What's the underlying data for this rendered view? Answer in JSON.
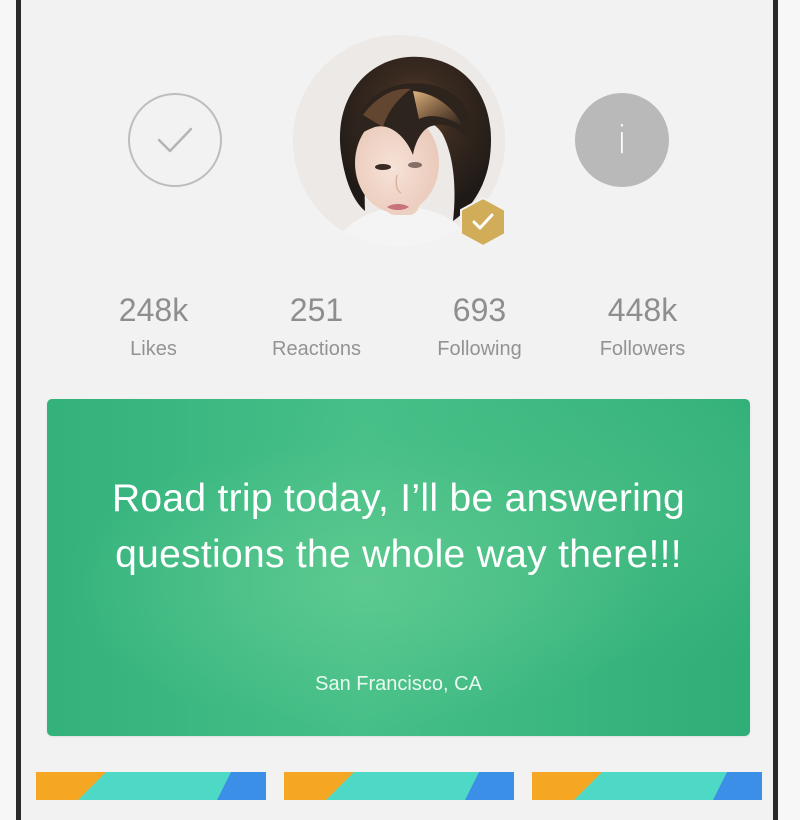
{
  "profile": {
    "avatar_alt": "Profile photo",
    "verified": true
  },
  "stats": [
    {
      "value": "248k",
      "label": "Likes"
    },
    {
      "value": "251",
      "label": "Reactions"
    },
    {
      "value": "693",
      "label": "Following"
    },
    {
      "value": "448k",
      "label": "Followers"
    }
  ],
  "info_button": {
    "glyph": "i"
  },
  "status": {
    "text": "Road trip today, I’ll be answering questions the whole way there!!!",
    "location": "San Francisco, CA"
  },
  "colors": {
    "card_green": "#3bb882",
    "badge_gold": "#d1ad5a",
    "tile_orange": "#f5a623",
    "tile_teal": "#4ed8c6",
    "tile_blue": "#3b8fe6"
  },
  "icons": {
    "check_button": "checkmark-icon",
    "info_button": "info-icon",
    "verified": "verified-badge-icon"
  }
}
